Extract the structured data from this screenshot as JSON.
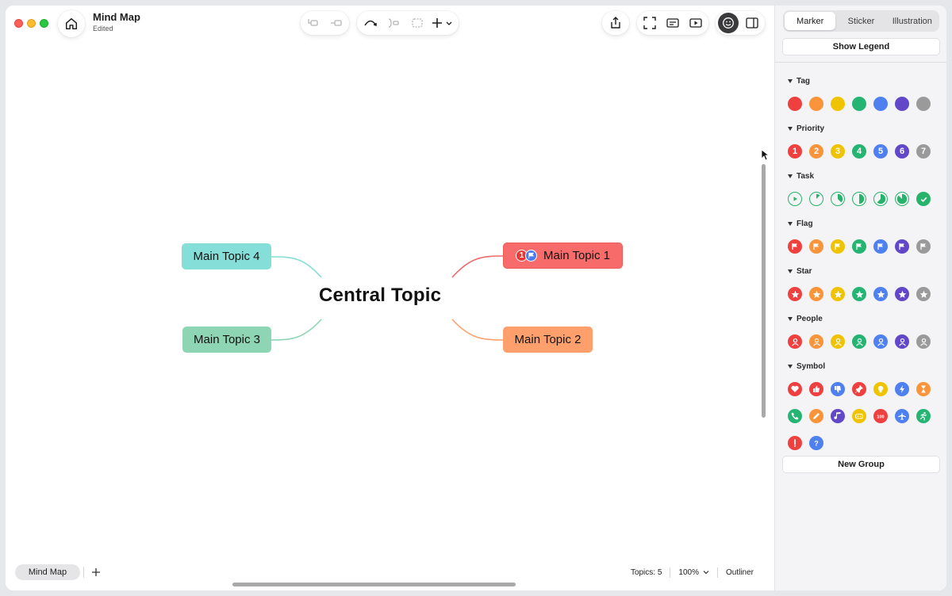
{
  "window": {
    "title": "Mind Map",
    "status": "Edited"
  },
  "mindmap": {
    "central": "Central Topic",
    "topics": [
      "Main Topic 1",
      "Main Topic 2",
      "Main Topic 3",
      "Main Topic 4"
    ],
    "topic1_markers": {
      "priority": "1",
      "flag": "flag-icon"
    }
  },
  "footer": {
    "sheet_tab": "Mind Map",
    "topics_count": "Topics: 5",
    "zoom": "100%",
    "outliner": "Outliner"
  },
  "sidebar": {
    "tabs": [
      "Marker",
      "Sticker",
      "Illustration"
    ],
    "active_tab": "Marker",
    "show_legend": "Show Legend",
    "new_group": "New Group",
    "groups": [
      "Tag",
      "Priority",
      "Task",
      "Flag",
      "Star",
      "People",
      "Symbol"
    ],
    "priority_numbers": [
      "1",
      "2",
      "3",
      "4",
      "5",
      "6",
      "7"
    ],
    "colors": [
      "#ef4040",
      "#f9943b",
      "#f0c300",
      "#26b473",
      "#4f80f0",
      "#6248c8",
      "#9a9a9a"
    ],
    "symbols": [
      "heart-icon",
      "thumbs-up-icon",
      "thumbs-down-icon",
      "pin-icon",
      "lightbulb-icon",
      "lightning-icon",
      "hourglass-icon",
      "phone-icon",
      "pencil-icon",
      "music-icon",
      "gamepad-icon",
      "hundred-icon",
      "airplane-icon",
      "runner-icon",
      "exclamation-icon",
      "question-icon"
    ],
    "symbol_colors": [
      "#ef4040",
      "#ef4040",
      "#4f80f0",
      "#ef4040",
      "#f0c300",
      "#4f80f0",
      "#f9943b",
      "#26b473",
      "#f9943b",
      "#6248c8",
      "#f0c300",
      "#ef4040",
      "#4f80f0",
      "#26b473",
      "#ef4040",
      "#4f80f0"
    ]
  }
}
